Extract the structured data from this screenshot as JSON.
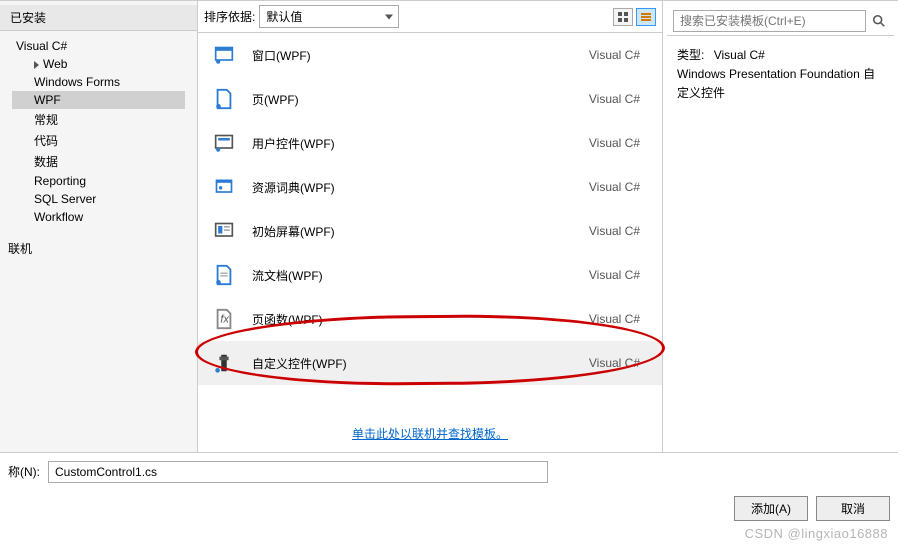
{
  "sidebar": {
    "installed_header": "已安装",
    "root": "Visual C#",
    "items": [
      "Web",
      "Windows Forms",
      "WPF",
      "常规",
      "代码",
      "数据",
      "Reporting",
      "SQL Server",
      "Workflow"
    ],
    "selected_index": 2,
    "online_header": "联机"
  },
  "center": {
    "sort_label": "排序依据:",
    "sort_value": "默认值",
    "templates": [
      {
        "name": "窗口(WPF)",
        "lang": "Visual C#"
      },
      {
        "name": "页(WPF)",
        "lang": "Visual C#"
      },
      {
        "name": "用户控件(WPF)",
        "lang": "Visual C#"
      },
      {
        "name": "资源词典(WPF)",
        "lang": "Visual C#"
      },
      {
        "name": "初始屏幕(WPF)",
        "lang": "Visual C#"
      },
      {
        "name": "流文档(WPF)",
        "lang": "Visual C#"
      },
      {
        "name": "页函数(WPF)",
        "lang": "Visual C#"
      },
      {
        "name": "自定义控件(WPF)",
        "lang": "Visual C#"
      }
    ],
    "selected_index": 7,
    "online_link": "单击此处以联机并查找模板。"
  },
  "info": {
    "search_placeholder": "搜索已安装模板(Ctrl+E)",
    "type_label": "类型:",
    "type_value": "Visual C#",
    "description": "Windows Presentation Foundation 自定义控件"
  },
  "bottom": {
    "name_label": "称(N):",
    "name_value": "CustomControl1.cs"
  },
  "footer": {
    "add": "添加(A)",
    "cancel": "取消"
  },
  "watermark": "CSDN @lingxiao16888"
}
